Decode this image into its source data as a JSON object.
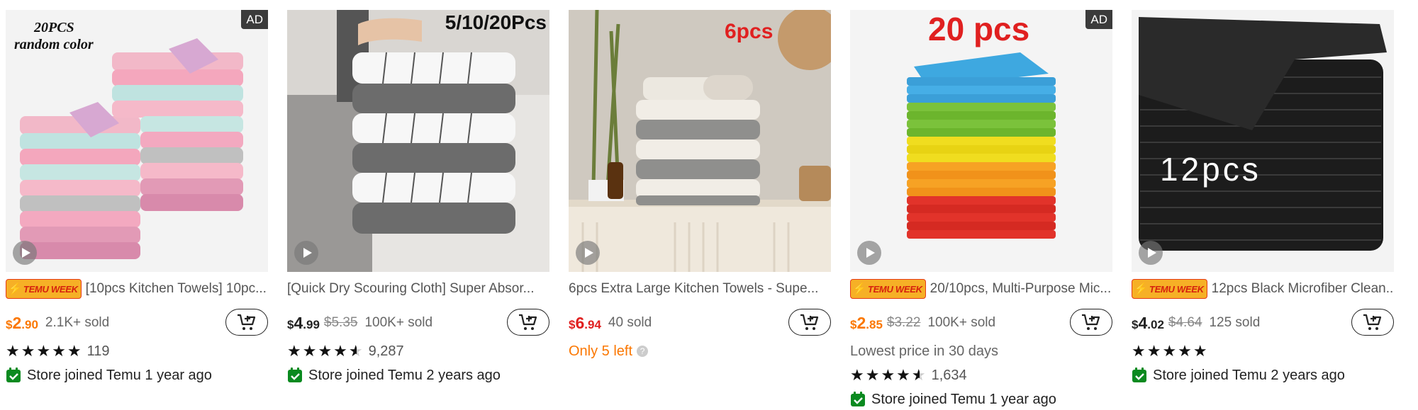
{
  "products": [
    {
      "ad_label": "AD",
      "image_text": [
        "20PCS",
        "random color"
      ],
      "badge": "TEMU WEEK",
      "title": "[10pcs Kitchen Towels] 10pc...",
      "price": {
        "currency": "$",
        "whole": "2",
        "cents": ".90"
      },
      "original_price": "",
      "sold": "2.1K+ sold",
      "rating": 5,
      "reviews": "119",
      "store": "Store joined Temu 1 year ago",
      "info": ""
    },
    {
      "ad_label": "",
      "image_text": [
        "5/10/20Pcs"
      ],
      "badge": "",
      "title": "[Quick Dry Scouring Cloth] Super Absor...",
      "price": {
        "currency": "$",
        "whole": "4",
        "cents": ".99"
      },
      "original_price": "$5.35",
      "sold": "100K+ sold",
      "rating": 4.5,
      "reviews": "9,287",
      "store": "Store joined Temu 2 years ago",
      "info": ""
    },
    {
      "ad_label": "",
      "image_text": [
        "6pcs"
      ],
      "badge": "",
      "title": "6pcs Extra Large Kitchen Towels - Supe...",
      "price": {
        "currency": "$",
        "whole": "6",
        "cents": ".94"
      },
      "original_price": "",
      "sold": "40 sold",
      "rating": null,
      "reviews": "",
      "store": "",
      "info": "Only 5 left"
    },
    {
      "ad_label": "AD",
      "image_text": [
        "20 pcs"
      ],
      "badge": "TEMU WEEK",
      "title": "20/10pcs, Multi-Purpose Mic...",
      "price": {
        "currency": "$",
        "whole": "2",
        "cents": ".85"
      },
      "original_price": "$3.22",
      "sold": "100K+ sold",
      "rating": 4.5,
      "reviews": "1,634",
      "store": "Store joined Temu 1 year ago",
      "info": "Lowest price in 30 days"
    },
    {
      "ad_label": "",
      "image_text": [
        "12pcs"
      ],
      "badge": "TEMU WEEK",
      "title": "12pcs Black Microfiber Clean...",
      "price": {
        "currency": "$",
        "whole": "4",
        "cents": ".02"
      },
      "original_price": "$4.64",
      "sold": "125 sold",
      "rating": 5,
      "reviews": "",
      "store": "Store joined Temu 2 years ago",
      "info": ""
    }
  ],
  "colors": {
    "price_orange": "#fb7701",
    "price_red": "#e02020",
    "store_green": "#0a8a1f",
    "badge_yellow": "#f6b026"
  },
  "icons": [
    "play-icon",
    "cart-add-icon",
    "star-icon",
    "calendar-check-icon",
    "bolt-icon",
    "question-icon"
  ]
}
